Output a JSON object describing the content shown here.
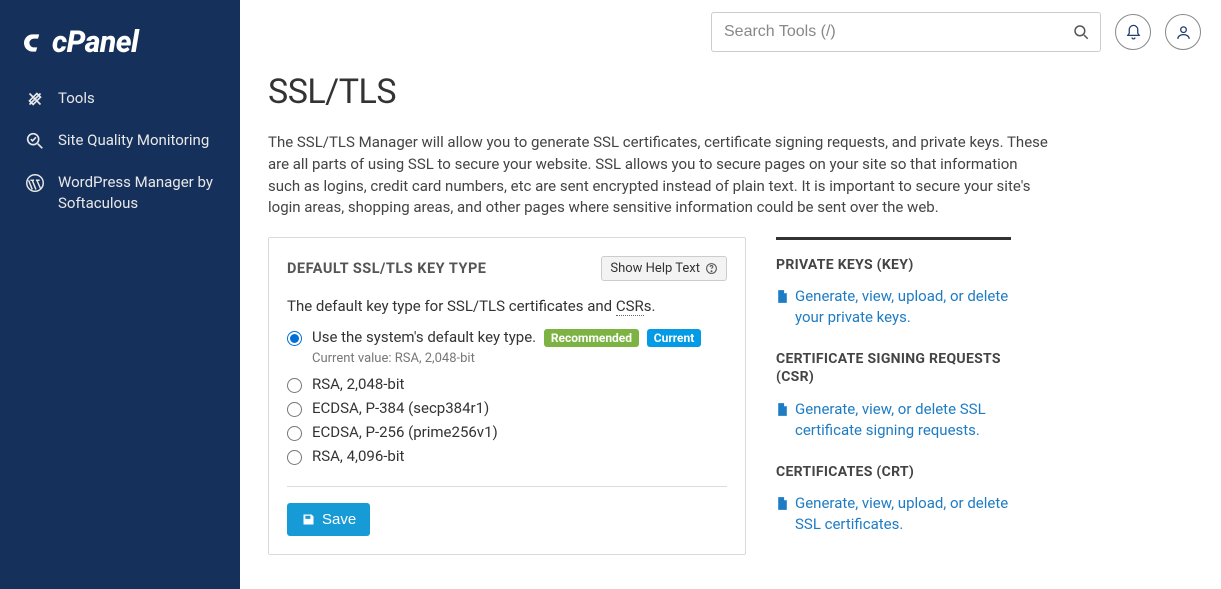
{
  "brand": "cPanel",
  "sidebar": {
    "items": [
      {
        "label": "Tools"
      },
      {
        "label": "Site Quality Monitoring"
      },
      {
        "label": "WordPress Manager by Softaculous"
      }
    ]
  },
  "search": {
    "placeholder": "Search Tools (/)"
  },
  "page": {
    "title": "SSL/TLS",
    "description": "The SSL/TLS Manager will allow you to generate SSL certificates, certificate signing requests, and private keys. These are all parts of using SSL to secure your website. SSL allows you to secure pages on your site so that information such as logins, credit card numbers, etc are sent encrypted instead of plain text. It is important to secure your site's login areas, shopping areas, and other pages where sensitive information could be sent over the web."
  },
  "card": {
    "title": "DEFAULT SSL/TLS KEY TYPE",
    "help_btn": "Show Help Text",
    "subdesc_prefix": "The default key type for SSL/TLS certificates and ",
    "subdesc_abbr": "CSR",
    "subdesc_suffix": "s.",
    "options": [
      {
        "label": "Use the system's default key type.",
        "recommended": "Recommended",
        "current": "Current",
        "current_value": "Current value: RSA, 2,048-bit"
      },
      {
        "label": "RSA, 2,048-bit"
      },
      {
        "label": "ECDSA, P-384 (secp384r1)"
      },
      {
        "label": "ECDSA, P-256 (prime256v1)"
      },
      {
        "label": "RSA, 4,096-bit"
      }
    ],
    "save": "Save"
  },
  "right": {
    "sections": [
      {
        "heading": "PRIVATE KEYS (KEY)",
        "link": "Generate, view, upload, or delete your private keys."
      },
      {
        "heading": "CERTIFICATE SIGNING REQUESTS (CSR)",
        "link": "Generate, view, or delete SSL certificate signing requests."
      },
      {
        "heading": "CERTIFICATES (CRT)",
        "link": "Generate, view, upload, or delete SSL certificates."
      }
    ]
  }
}
